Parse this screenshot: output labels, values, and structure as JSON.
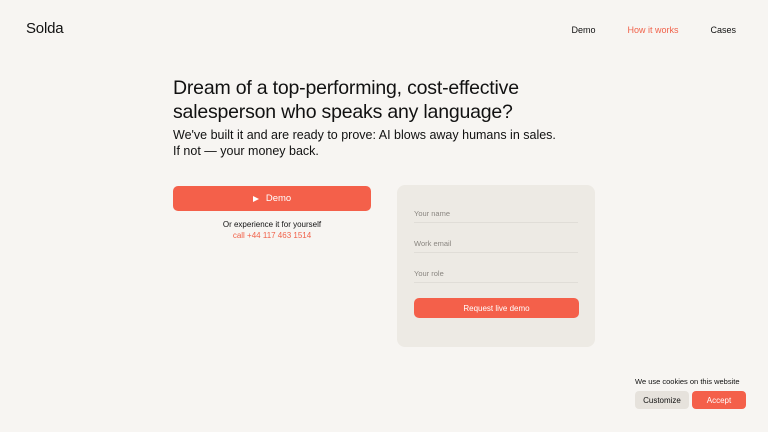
{
  "header": {
    "logo": "Solda",
    "nav": [
      {
        "label": "Demo"
      },
      {
        "label": "How it works"
      },
      {
        "label": "Cases"
      }
    ]
  },
  "hero": {
    "headline": "Dream of a top-performing, cost-effective salesperson who speaks any language?",
    "subline_1": "We've built it and are ready to prove: AI blows away humans in sales.",
    "subline_2": "If not — your money back.",
    "demo_button": "Demo",
    "try_text": "Or experience it for yourself",
    "phone": "call +44 117 463 1514"
  },
  "form": {
    "name_placeholder": "Your name",
    "email_placeholder": "Work email",
    "role_placeholder": "Your role",
    "submit": "Request live demo"
  },
  "cookies": {
    "text": "We use cookies on this website",
    "customize": "Customize",
    "accept": "Accept"
  },
  "colors": {
    "accent": "#f4604a",
    "background": "#f7f5f2",
    "card": "#edeae4"
  }
}
